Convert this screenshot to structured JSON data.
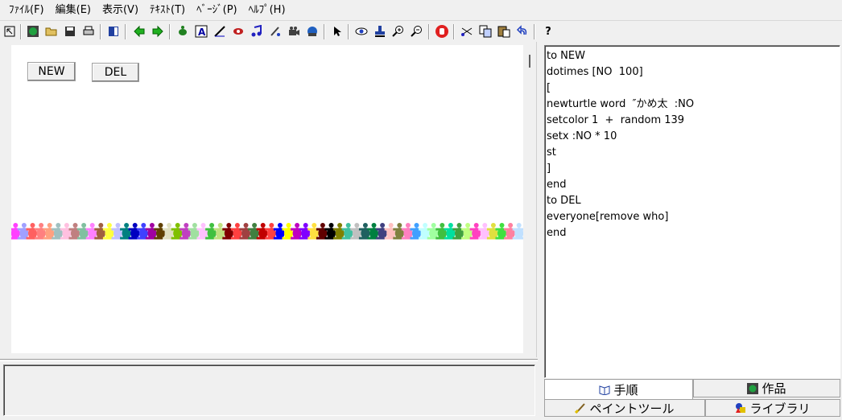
{
  "menubar": {
    "items": [
      "ﾌｧｲﾙ(F)",
      "編集(E)",
      "表示(V)",
      "ﾃｷｽﾄ(T)",
      "ﾍﾞｰｼﾞ(P)",
      "ﾍﾙﾌﾟ(H)"
    ]
  },
  "toolbar": {
    "help_label": "?"
  },
  "canvas": {
    "buttons": {
      "new_label": "NEW",
      "del_label": "DEL"
    },
    "turtle_colors": [
      "#ff40ff",
      "#a0a0ff",
      "#ff6060",
      "#ff8080",
      "#ffa080",
      "#a0c0c0",
      "#ffc0e0",
      "#c08080",
      "#80c0a0",
      "#ff80ff",
      "#a06040",
      "#ffff40",
      "#c0c0ff",
      "#008080",
      "#0000c0",
      "#4040ff",
      "#a000a0",
      "#604000",
      "#e0e0c0",
      "#80c000",
      "#c040c0",
      "#a0e0a0",
      "#ffc0ff",
      "#40c040",
      "#c0e080",
      "#800000",
      "#ff4040",
      "#a04040",
      "#408040",
      "#c00000",
      "#ff4040",
      "#0000ff",
      "#ffff00",
      "#c000c0",
      "#8000ff",
      "#ffe040",
      "#600000",
      "#000000",
      "#808000",
      "#40c0a0",
      "#c0c0c0",
      "#206060",
      "#008040",
      "#404080",
      "#ffc0c0",
      "#808040",
      "#ff80c0",
      "#40a0ff",
      "#c0ffff",
      "#a0ffa0",
      "#40c040",
      "#00e0a0",
      "#40a040",
      "#c0ff80",
      "#ff40c0",
      "#ffc0ff",
      "#e0e040",
      "#40e040",
      "#ff80a0",
      "#c0e0ff"
    ]
  },
  "editor": {
    "lines": [
      "to NEW",
      "dotimes [NO  100]",
      "[",
      "newturtle word  ″かめ太  :NO",
      "setcolor 1  +  random 139",
      "setx :NO * 10",
      "st",
      "]",
      "end",
      "to DEL",
      "everyone[remove who]",
      "end"
    ]
  },
  "tabs": {
    "steps": "手順",
    "works": "作品",
    "paint": "ペイントツール",
    "library": "ライブラリ"
  }
}
